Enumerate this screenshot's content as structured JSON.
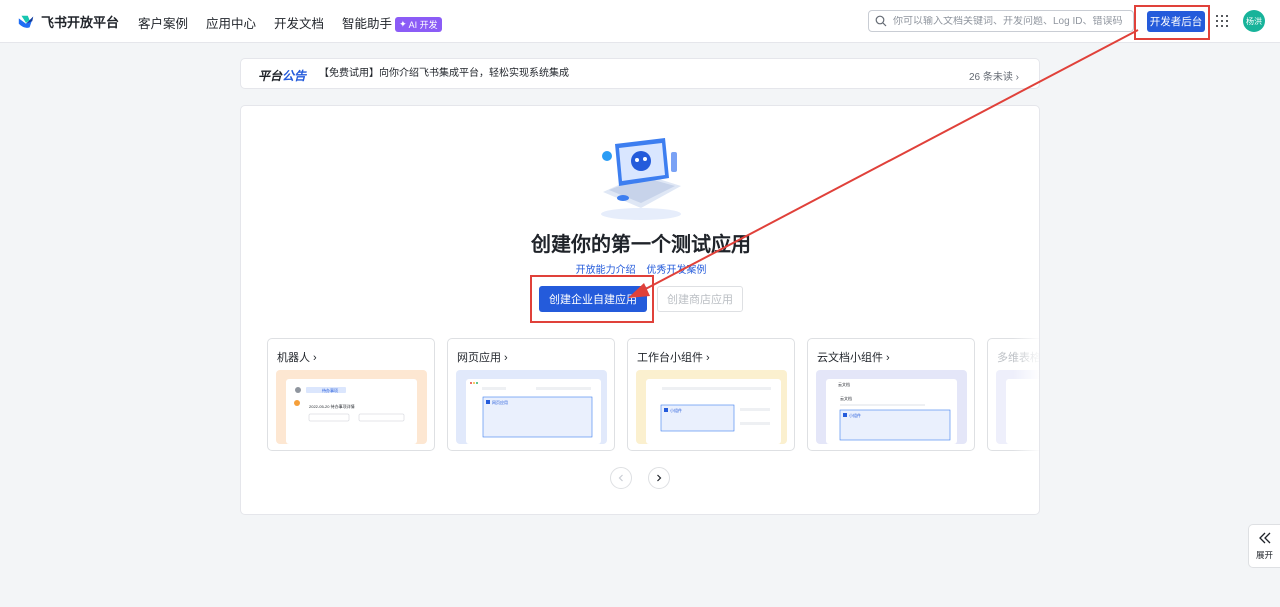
{
  "nav": {
    "logo_text": "飞书开放平台",
    "links": [
      "客户案例",
      "应用中心",
      "开发文档",
      "智能助手"
    ],
    "ai_badge": "AI 开发",
    "search_placeholder": "你可以输入文档关键词、开发问题、Log ID、错误码",
    "dev_console_label": "开发者后台",
    "avatar_text": "杨洪"
  },
  "announcement": {
    "title_a": "平台",
    "title_b": "公告",
    "text": "【免费试用】向你介绍飞书集成平台，轻松实现系统集成",
    "unread": "26 条未读"
  },
  "main": {
    "heading": "创建你的第一个测试应用",
    "link_capabilities": "开放能力介绍",
    "link_cases": "优秀开发案例",
    "create_enterprise_label": "创建企业自建应用",
    "create_store_label": "创建商店应用"
  },
  "templates": [
    {
      "title": "机器人",
      "preview_color": "#fde7d2",
      "preview_text_a": "待办事项",
      "preview_text_b": "2022-05-20 待办事项详情"
    },
    {
      "title": "网页应用",
      "preview_color": "#e1e9fb",
      "preview_text_a": "网页应用"
    },
    {
      "title": "工作台小组件",
      "preview_color": "#fbf0cf",
      "preview_text_a": "小组件"
    },
    {
      "title": "云文档小组件",
      "preview_color": "#e4e6f8",
      "preview_text_a": "云文档",
      "preview_text_b": "小组件"
    },
    {
      "title": "多维表格",
      "preview_color": "#eeeffb"
    }
  ],
  "side": {
    "expand_label": "展开"
  },
  "colors": {
    "primary": "#245bdb",
    "highlight": "#e0413a"
  }
}
